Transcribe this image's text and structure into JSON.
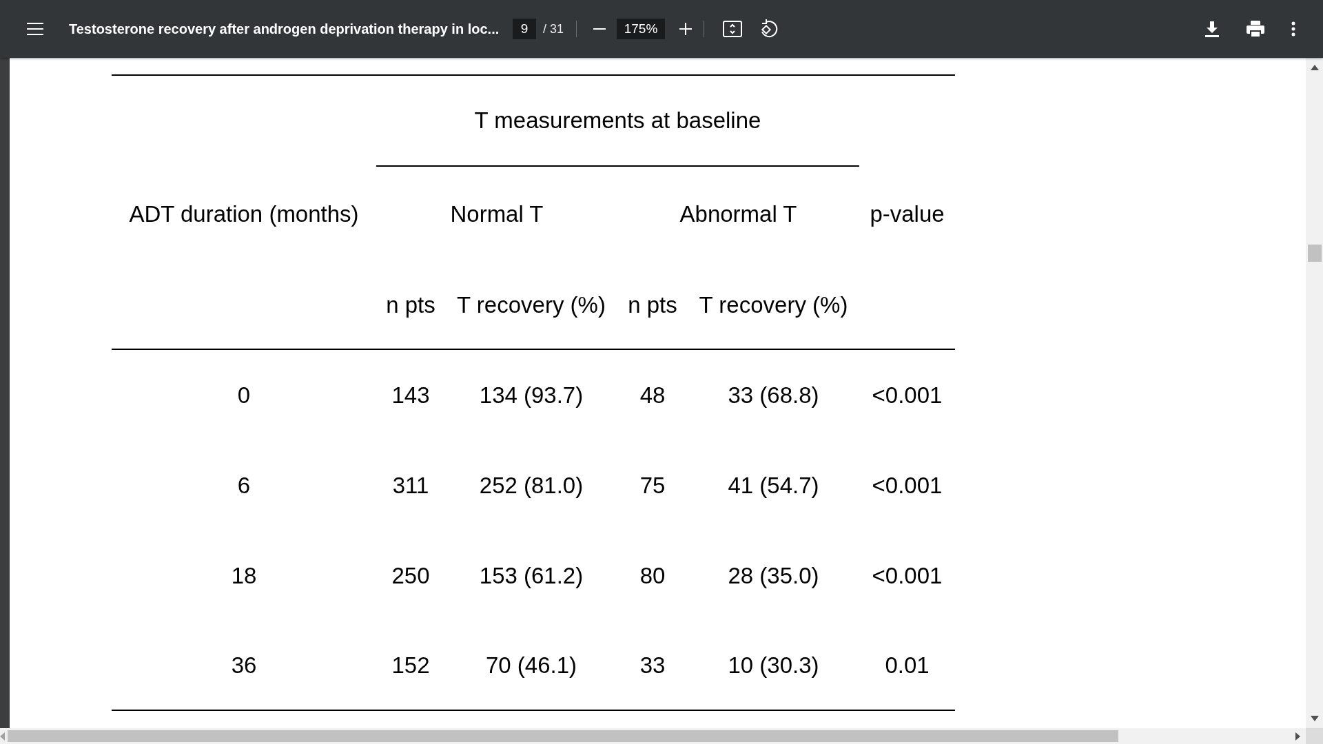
{
  "toolbar": {
    "title": "Testosterone recovery after androgen deprivation therapy in loc...",
    "page": "9",
    "page_count": "/ 31",
    "zoom": "175%"
  },
  "table": {
    "group_header": "T measurements at baseline",
    "first_column": "ADT duration (months)",
    "groups": [
      "Normal T",
      "Abnormal T"
    ],
    "last_column": "p-value",
    "subcolumns": [
      "n pts",
      "T recovery (%)",
      "n pts",
      "T recovery (%)"
    ],
    "rows": [
      [
        "0",
        "143",
        "134 (93.7)",
        "48",
        "33 (68.8)",
        "<0.001"
      ],
      [
        "6",
        "311",
        "252 (81.0)",
        "75",
        "41 (54.7)",
        "<0.001"
      ],
      [
        "18",
        "250",
        "153 (61.2)",
        "80",
        "28 (35.0)",
        "<0.001"
      ],
      [
        "36",
        "152",
        "70 (46.1)",
        "33",
        "10 (30.3)",
        "0.01"
      ]
    ]
  }
}
